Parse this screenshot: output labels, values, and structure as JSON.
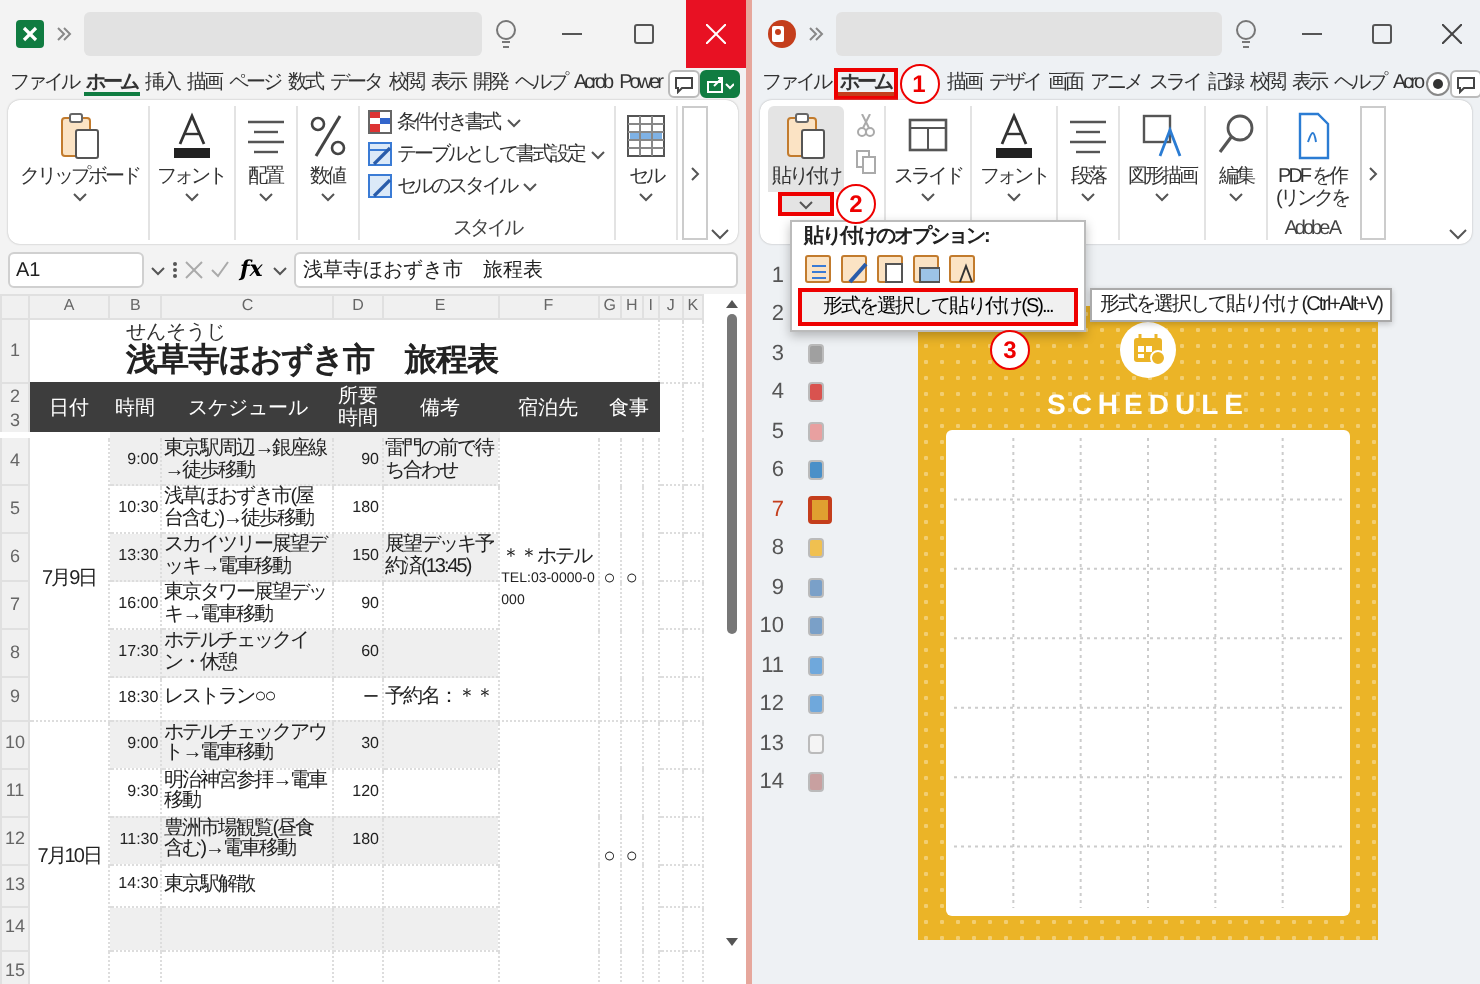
{
  "excel": {
    "tabs": [
      {
        "label": "ファイル",
        "selected": false
      },
      {
        "label": "ホーム",
        "selected": true
      },
      {
        "label": "挿入",
        "selected": false
      },
      {
        "label": "描画",
        "selected": false
      },
      {
        "label": "ページ",
        "selected": false
      },
      {
        "label": "数式",
        "selected": false
      },
      {
        "label": "データ",
        "selected": false
      },
      {
        "label": "校閲",
        "selected": false
      },
      {
        "label": "表示",
        "selected": false
      },
      {
        "label": "開発",
        "selected": false
      },
      {
        "label": "ヘルプ",
        "selected": false
      },
      {
        "label": "Acrob",
        "selected": false
      },
      {
        "label": "Power",
        "selected": false
      }
    ],
    "ribbon_groups": [
      {
        "kind": "large",
        "label": "クリップボード"
      },
      {
        "kind": "large",
        "label": "フォント"
      },
      {
        "kind": "large",
        "label": "配置"
      },
      {
        "kind": "large",
        "label": "数値"
      },
      {
        "kind": "list",
        "items": [
          "条件付き書式",
          "テーブルとして書式設定",
          "セルのスタイル"
        ],
        "group_label": "スタイル"
      },
      {
        "kind": "large",
        "label": "セル"
      }
    ],
    "name_box": "A1",
    "function_label": "fx",
    "formula": "浅草寺ほおずき市　旅程表",
    "column_letters": [
      "A",
      "B",
      "C",
      "D",
      "E",
      "F",
      "G",
      "H",
      "I",
      "J",
      "K"
    ],
    "row_numbers": [
      "1",
      "2",
      "3",
      "4",
      "5",
      "6",
      "7",
      "8",
      "9",
      "10",
      "11",
      "12",
      "13",
      "14",
      "15"
    ],
    "sheet": {
      "ruby": "せんそうじ",
      "title": "浅草寺ほおずき市　旅程表",
      "headers": [
        "日付",
        "時間",
        "スケジュール",
        "所要時間",
        "備考",
        "宿泊先",
        "食事"
      ],
      "days": [
        {
          "date": "7月9日",
          "lodging": [
            "＊＊ホテル",
            "TEL:03-0000-0000"
          ],
          "meals": [
            "○",
            "○"
          ],
          "rows": [
            {
              "time": "9:00",
              "schedule": "東京駅周辺→銀座線→徒歩移動",
              "duration": "90",
              "note": "雷門の前で待ち合わせ"
            },
            {
              "time": "10:30",
              "schedule": "浅草ほおずき市(屋台含む)→徒歩移動",
              "duration": "180"
            },
            {
              "time": "13:30",
              "schedule": "スカイツリー展望デッキ→電車移動",
              "duration": "150",
              "note": "展望デッキ予約済(13:45)"
            },
            {
              "time": "16:00",
              "schedule": "東京タワー展望デッキ→電車移動",
              "duration": "90"
            },
            {
              "time": "17:30",
              "schedule": "ホテルチェックイン・休憩",
              "duration": "60"
            },
            {
              "time": "18:30",
              "schedule": "レストラン○○",
              "duration": "ー",
              "note": "予約名：＊＊"
            }
          ]
        },
        {
          "date": "7月10日",
          "meals": [
            "○",
            "○"
          ],
          "rows": [
            {
              "time": "9:00",
              "schedule": "ホテルチェックアウト→電車移動",
              "duration": "30"
            },
            {
              "time": "9:30",
              "schedule": "明治神宮参拝→電車移動",
              "duration": "120"
            },
            {
              "time": "11:30",
              "schedule": "豊洲市場観覧(昼食含む)→電車移動",
              "duration": "180"
            },
            {
              "time": "14:30",
              "schedule": "東京駅解散"
            }
          ]
        }
      ]
    }
  },
  "powerpoint": {
    "tabs": [
      {
        "label": "ファイル",
        "selected": false,
        "highlighted": false
      },
      {
        "label": "ホーム",
        "selected": true,
        "highlighted": true,
        "step": "1"
      },
      {
        "label": "描画",
        "selected": false,
        "highlighted": false
      },
      {
        "label": "デザイ",
        "selected": false,
        "highlighted": false
      },
      {
        "label": "画面",
        "selected": false,
        "highlighted": false
      },
      {
        "label": "アニメ",
        "selected": false,
        "highlighted": false
      },
      {
        "label": "スライ",
        "selected": false,
        "highlighted": false
      },
      {
        "label": "記録",
        "selected": false,
        "highlighted": false
      },
      {
        "label": "校閲",
        "selected": false,
        "highlighted": false
      },
      {
        "label": "表示",
        "selected": false,
        "highlighted": false
      },
      {
        "label": "ヘルプ",
        "selected": false,
        "highlighted": false
      },
      {
        "label": "Acro",
        "selected": false,
        "highlighted": false
      }
    ],
    "ribbon_groups": [
      {
        "kind": "paste",
        "label": "貼り付け",
        "expanded": true,
        "highlighted": true,
        "step": "2"
      },
      {
        "kind": "small",
        "disabled": true
      },
      {
        "kind": "large",
        "label": "スライド"
      },
      {
        "kind": "large",
        "label": "フォント"
      },
      {
        "kind": "large",
        "label": "段落"
      },
      {
        "kind": "large",
        "label": "図形描画"
      },
      {
        "kind": "large",
        "label": "編集"
      },
      {
        "kind": "large",
        "label_lines": [
          "PDF を作",
          "(リンクを"
        ],
        "group_label": "Adobe A"
      }
    ],
    "paste_menu": {
      "heading": "貼り付けのオプション:",
      "item": {
        "label": "形式を選択して貼り付け(S)...",
        "highlighted": true,
        "step": "3"
      },
      "tooltip": "形式を選択して貼り付け (Ctrl+Alt+V)"
    },
    "thumbnails": [
      {
        "number": "1",
        "selected": false
      },
      {
        "number": "2",
        "selected": false
      },
      {
        "number": "3",
        "selected": false,
        "color": "#a0a0a0"
      },
      {
        "number": "4",
        "selected": false,
        "color": "#d9534f"
      },
      {
        "number": "5",
        "selected": false,
        "color": "#e8a0a0"
      },
      {
        "number": "6",
        "selected": false,
        "color": "#4a90c8"
      },
      {
        "number": "7",
        "selected": true,
        "color": "#e0a030"
      },
      {
        "number": "8",
        "selected": false,
        "color": "#f0c050"
      },
      {
        "number": "9",
        "selected": false,
        "color": "#7aa0c8"
      },
      {
        "number": "10",
        "selected": false,
        "color": "#7aa0c8"
      },
      {
        "number": "11",
        "selected": false,
        "color": "#6fa8dc"
      },
      {
        "number": "12",
        "selected": false,
        "color": "#6fa8dc"
      },
      {
        "number": "13",
        "selected": false,
        "color": "#f4f4f4"
      },
      {
        "number": "14",
        "selected": false,
        "color": "#c8a0a0"
      }
    ],
    "slide": {
      "title": "SCHEDULE"
    }
  }
}
